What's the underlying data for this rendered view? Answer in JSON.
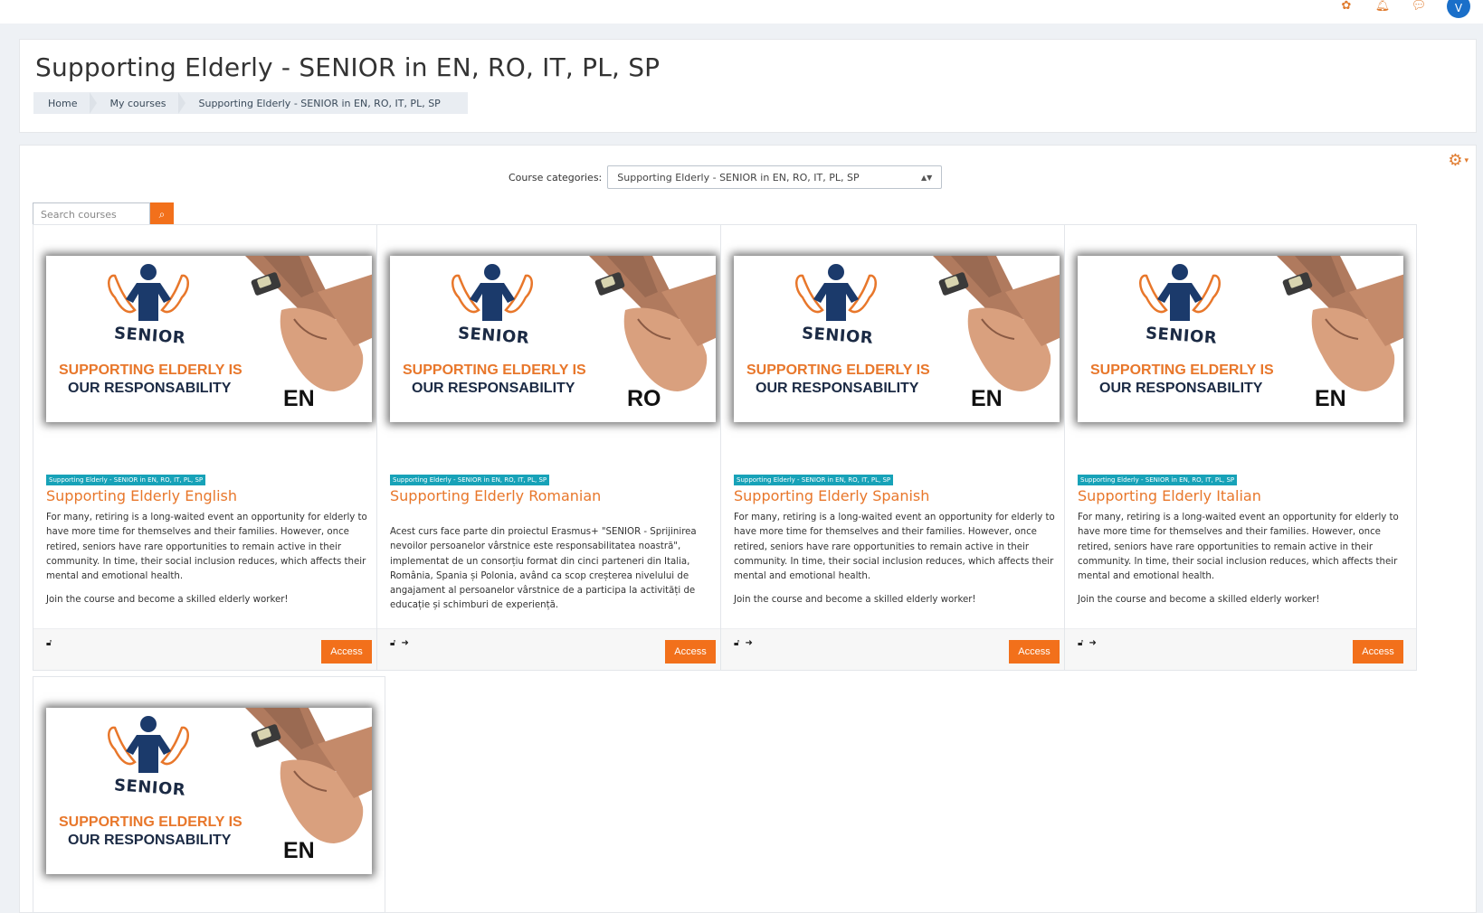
{
  "topbar": {
    "icons": [
      "puzzle-icon",
      "bell-icon",
      "chat-icon"
    ],
    "avatar_initial": "V"
  },
  "header": {
    "title": "Supporting Elderly - SENIOR in EN, RO, IT, PL, SP",
    "breadcrumb": [
      "Home",
      "My courses",
      "Supporting Elderly - SENIOR in EN, RO, IT, PL, SP"
    ]
  },
  "filters": {
    "category_label": "Course categories:",
    "category_selected": "Supporting Elderly - SENIOR in EN, RO, IT, PL, SP",
    "search_placeholder": "Search courses"
  },
  "banner_text": {
    "senior": "SENIOR",
    "line1": "SUPPORTING ELDERLY IS",
    "line2": "OUR RESPONSABILITY"
  },
  "courses": [
    {
      "banner_lang": "EN",
      "category": "Supporting Elderly - SENIOR in EN, RO, IT, PL, SP",
      "name": "Supporting Elderly English",
      "desc": [
        "For many, retiring is a long-waited event an opportunity for elderly to have more time for themselves and their families. However, once retired, seniors have rare opportunities to remain active in their community. In time, their social inclusion reduces, which affects their mental and emotional health.",
        "Join the course and become a skilled elderly worker!"
      ],
      "access_label": "Access"
    },
    {
      "banner_lang": "RO",
      "category": "Supporting Elderly - SENIOR in EN, RO, IT, PL, SP",
      "name": "Supporting Elderly Romanian",
      "desc": [
        "Acest curs face parte din proiectul Erasmus+ \"SENIOR - Sprijinirea nevoilor persoanelor vârstnice este responsabilitatea noastră\", implementat de un consorțiu format din cinci parteneri din Italia, România, Spania și Polonia, având ca scop creșterea nivelului de angajament al persoanelor vârstnice de a participa la activități de educație și schimburi de experiență."
      ],
      "access_label": "Access"
    },
    {
      "banner_lang": "EN",
      "category": "Supporting Elderly - SENIOR in EN, RO, IT, PL, SP",
      "name": "Supporting Elderly Spanish",
      "desc": [
        "For many, retiring is a long-waited event an opportunity for elderly to have more time for themselves and their families. However, once retired, seniors have rare opportunities to remain active in their community. In time, their social inclusion reduces, which affects their mental and emotional health.",
        "Join the course and become a skilled elderly worker!"
      ],
      "access_label": "Access"
    },
    {
      "banner_lang": "EN",
      "category": "Supporting Elderly - SENIOR in EN, RO, IT, PL, SP",
      "name": "Supporting Elderly Italian",
      "desc": [
        "For many, retiring is a long-waited event an opportunity for elderly to have more time for themselves and their families. However, once retired, seniors have rare opportunities to remain active in their community. In time, their social inclusion reduces, which affects their mental and emotional health.",
        "Join the course and become a skilled elderly worker!"
      ],
      "access_label": "Access"
    },
    {
      "banner_lang": "EN"
    }
  ],
  "colors": {
    "accent": "#f2701b",
    "course_name": "#e8772b",
    "badge": "#17a2b8",
    "navy": "#1b2a44"
  }
}
